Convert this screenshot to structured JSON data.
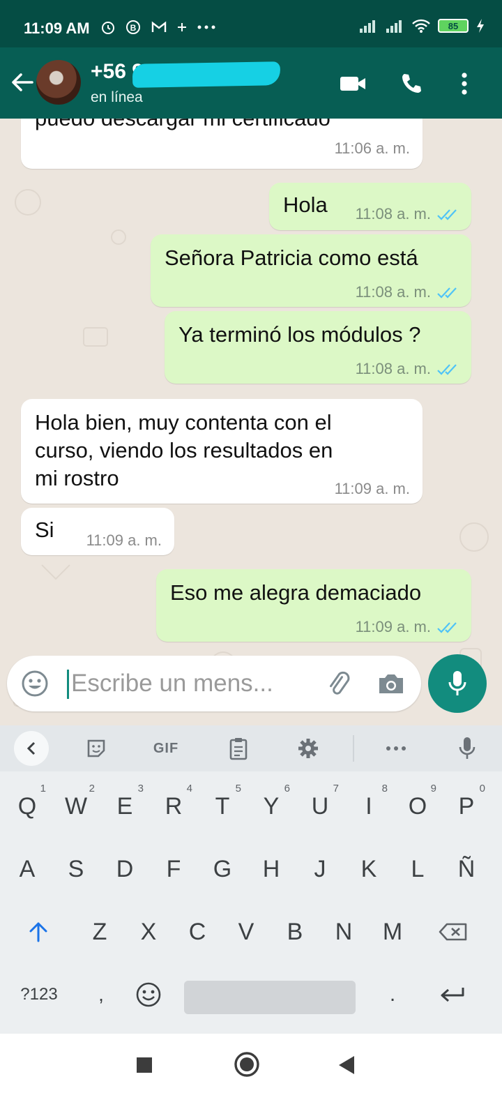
{
  "status_bar": {
    "time": "11:09 AM",
    "battery": "85",
    "left_icons": [
      "alarm-icon",
      "b-circle-icon",
      "gmail-icon",
      "sparkle-icon",
      "more-dots-icon"
    ],
    "right_icons": [
      "signal-icon",
      "signal-icon",
      "wifi-icon",
      "battery-icon",
      "charging-icon"
    ]
  },
  "header": {
    "contact_name": "+56 9",
    "status": "en línea",
    "accent": "#075e54"
  },
  "messages": [
    {
      "dir": "in",
      "lines": [
        "puedo descargar mi certificado"
      ],
      "time": "11:06 a. m."
    },
    {
      "dir": "out",
      "lines": [
        "Hola"
      ],
      "time": "11:08 a. m.",
      "read": true
    },
    {
      "dir": "out",
      "lines": [
        "Señora Patricia como está"
      ],
      "time": "11:08 a. m.",
      "read": true
    },
    {
      "dir": "out",
      "lines": [
        "Ya terminó los módulos ?"
      ],
      "time": "11:08 a. m.",
      "read": true
    },
    {
      "dir": "in",
      "lines": [
        "Hola bien, muy contenta con el",
        "curso, viendo los resultados en",
        "mi rostro"
      ],
      "time": "11:09 a. m."
    },
    {
      "dir": "in",
      "lines": [
        "Si"
      ],
      "time": "11:09 a. m."
    },
    {
      "dir": "out",
      "lines": [
        "Eso me alegra demaciado"
      ],
      "time": "11:09 a. m.",
      "read": true
    }
  ],
  "composer": {
    "placeholder": "Escribe un mens..."
  },
  "keyboard": {
    "toolbar_gif": "GIF",
    "row1": [
      [
        "Q",
        "1"
      ],
      [
        "W",
        "2"
      ],
      [
        "E",
        "3"
      ],
      [
        "R",
        "4"
      ],
      [
        "T",
        "5"
      ],
      [
        "Y",
        "6"
      ],
      [
        "U",
        "7"
      ],
      [
        "I",
        "8"
      ],
      [
        "O",
        "9"
      ],
      [
        "P",
        "0"
      ]
    ],
    "row2": [
      "A",
      "S",
      "D",
      "F",
      "G",
      "H",
      "J",
      "K",
      "L",
      "Ñ"
    ],
    "row3": [
      "Z",
      "X",
      "C",
      "V",
      "B",
      "N",
      "M"
    ],
    "symbols": "?123",
    "comma": ",",
    "period": "."
  },
  "colors": {
    "incoming_bubble": "#ffffff",
    "outgoing_bubble": "#dcf8c6",
    "read_ticks": "#4fc3f7",
    "fab": "#128c7e"
  }
}
